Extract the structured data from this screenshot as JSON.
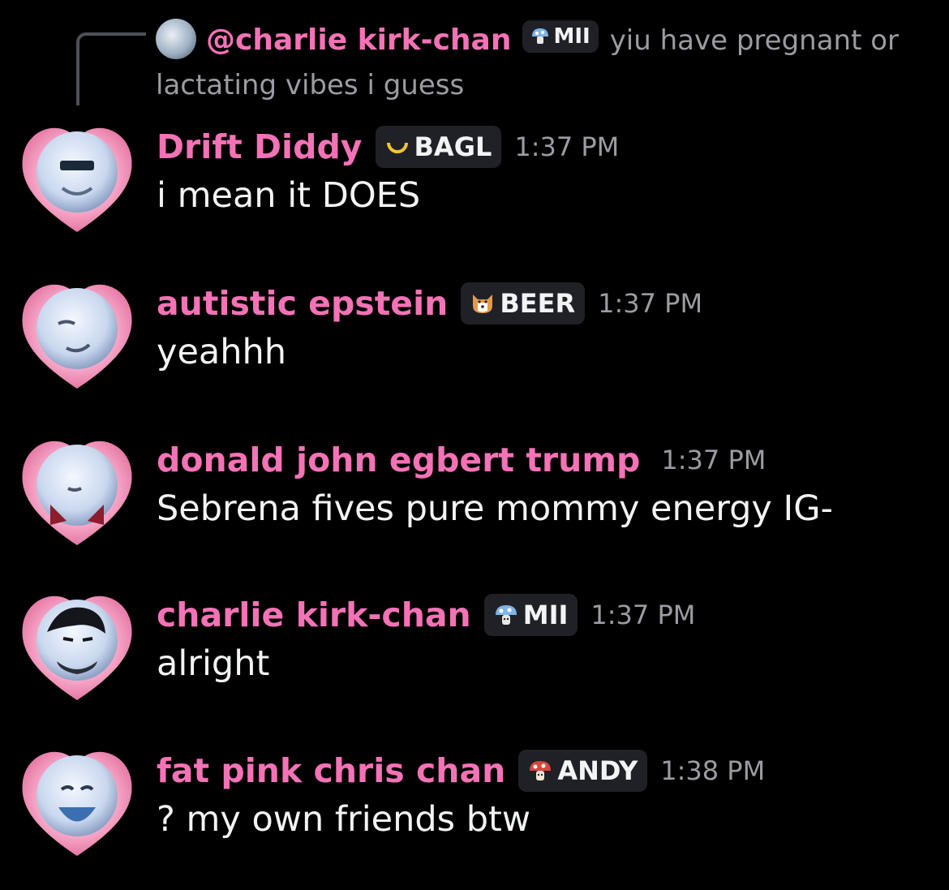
{
  "reply": {
    "author": "@charlie kirk-chan",
    "tag": "MII",
    "text": "yiu have pregnant or lactating vibes i guess"
  },
  "messages": [
    {
      "author": "Drift Diddy",
      "tag": "BAGL",
      "tag_icon": "crescent-moon-icon",
      "time": "1:37 PM",
      "text": "i mean it DOES"
    },
    {
      "author": "autistic epstein",
      "tag": "BEER",
      "tag_icon": "dog-face-icon",
      "time": "1:37 PM",
      "text": "yeahhh"
    },
    {
      "author": "donald john egbert trump",
      "tag": "",
      "time": "1:37 PM",
      "text": "Sebrena fives pure mommy energy IG-"
    },
    {
      "author": "charlie kirk-chan",
      "tag": "MII",
      "tag_icon": "blue-mushroom-icon",
      "time": "1:37 PM",
      "text": "alright"
    },
    {
      "author": "fat pink chris chan",
      "tag": "ANDY",
      "tag_icon": "red-mushroom-icon",
      "time": "1:38 PM",
      "text": "? my own friends btw"
    }
  ],
  "colors": {
    "background": "#000000",
    "username": "#f472b6",
    "text": "#f2f3f5",
    "muted": "#9b9ca3",
    "tag_bg": "#202126"
  }
}
